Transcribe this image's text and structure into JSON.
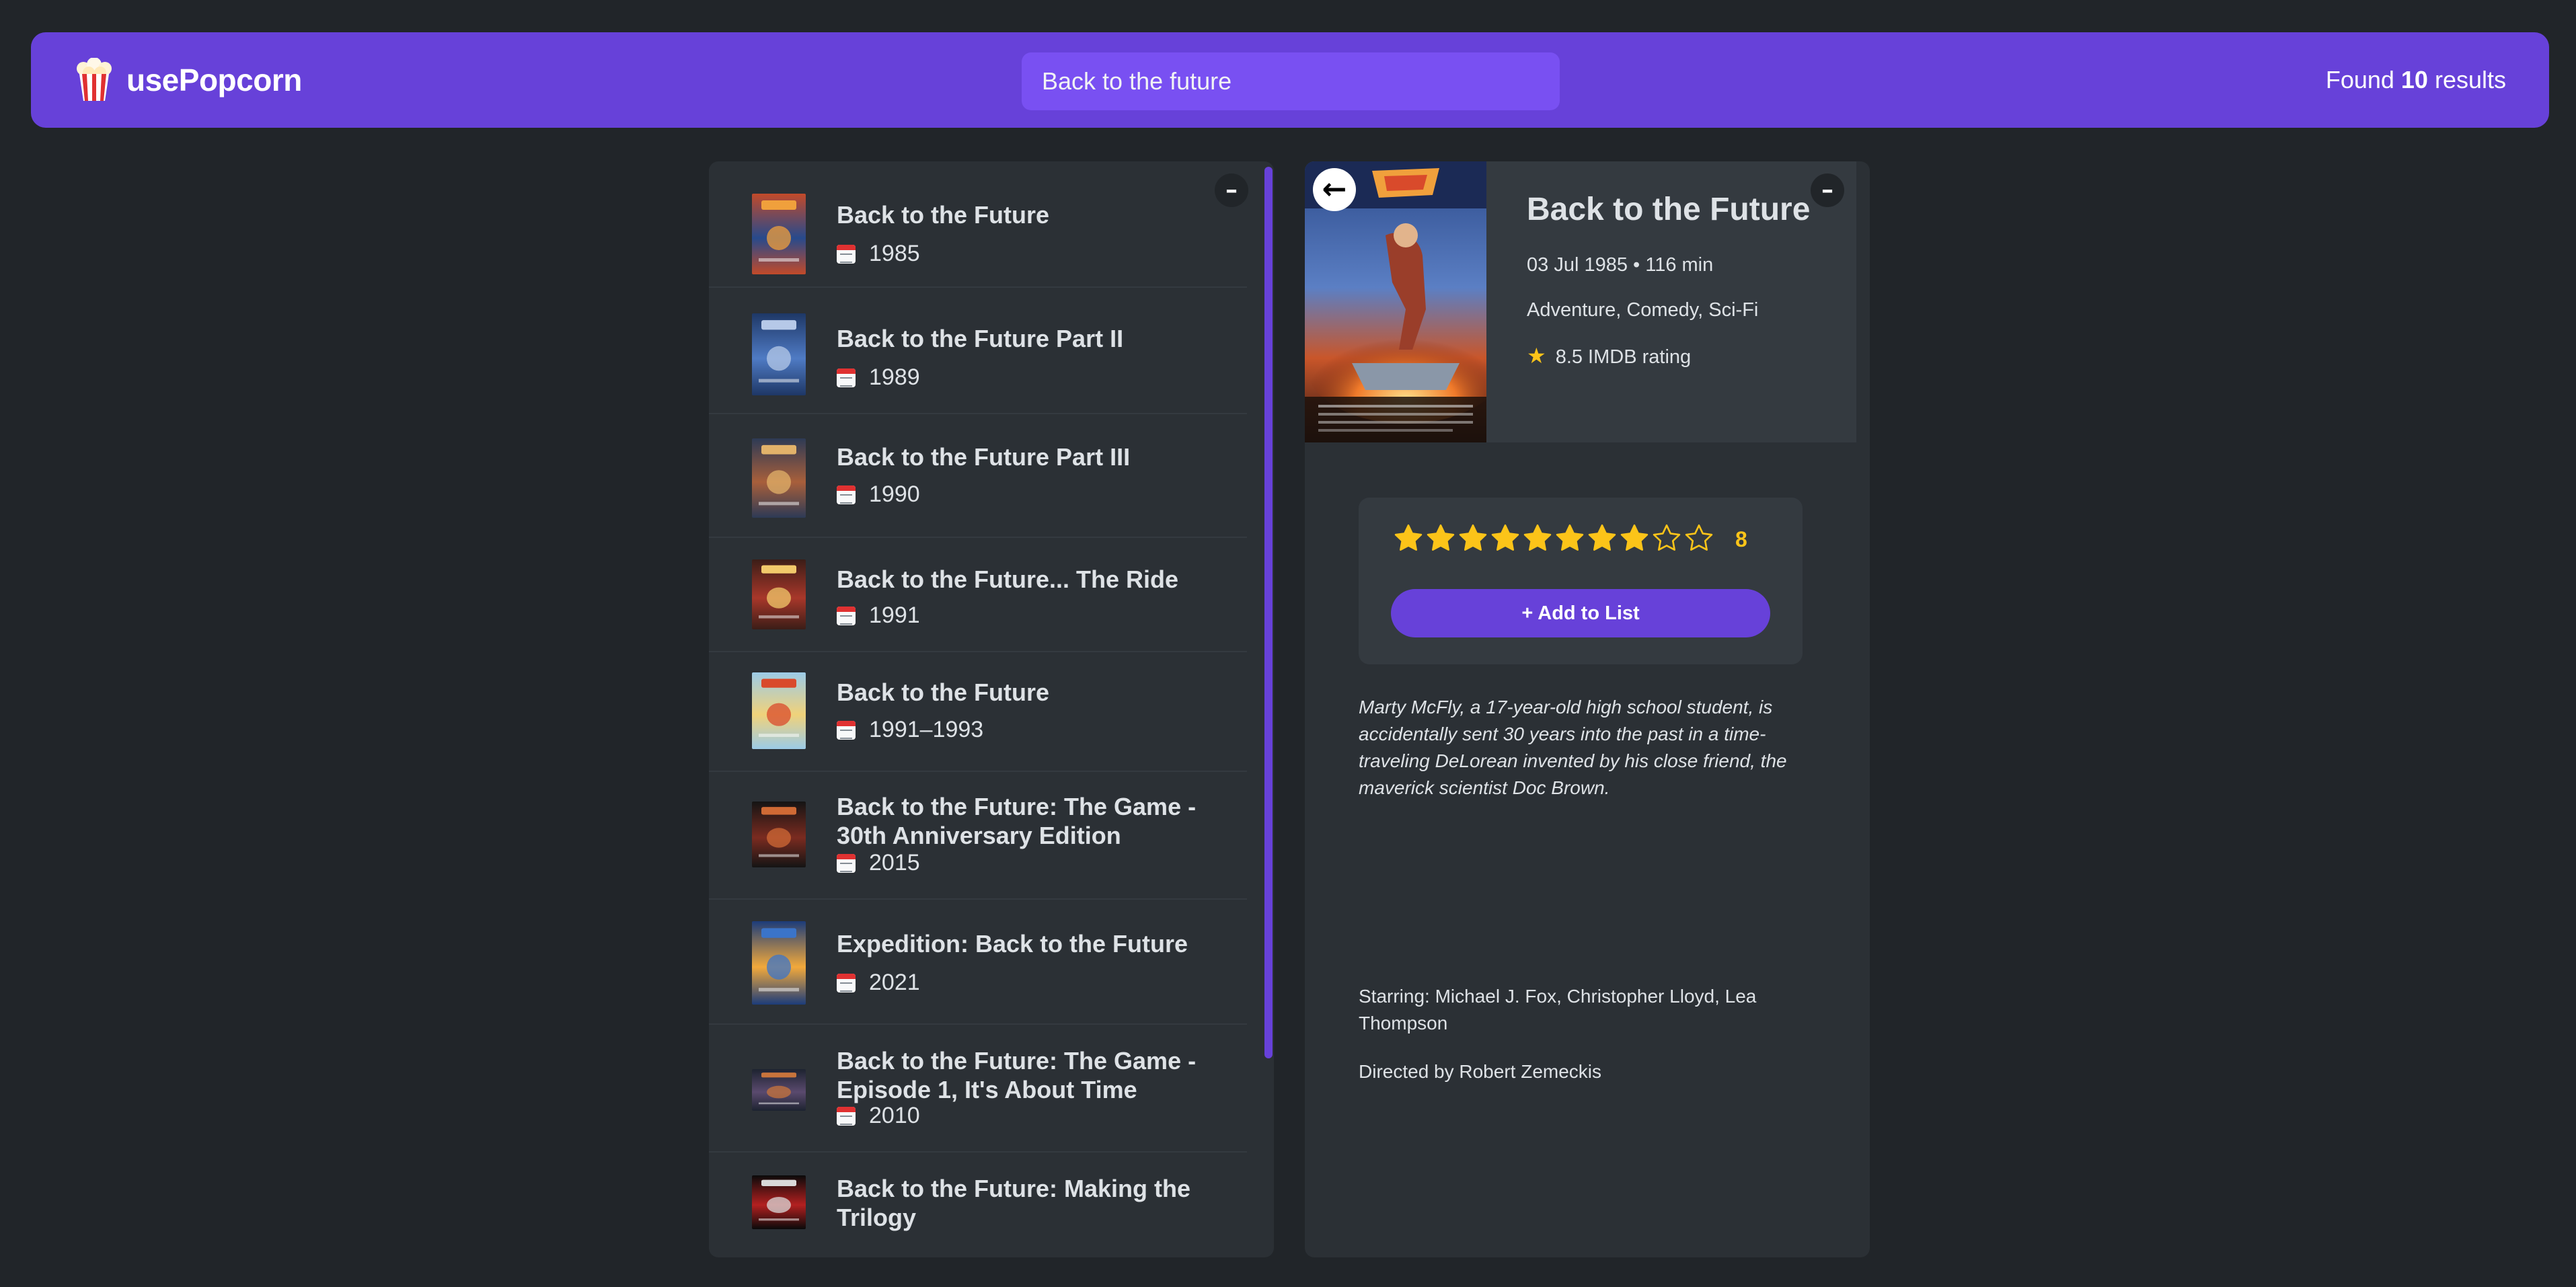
{
  "nav": {
    "logo_text": "usePopcorn",
    "search_value": "Back to the future",
    "results_prefix": "Found ",
    "results_count": "10",
    "results_suffix": " results"
  },
  "toggle_label": "–",
  "movies": [
    {
      "title": "Back to the Future",
      "year": "1985",
      "poster_colors": [
        "#c24a2a",
        "#274a8c",
        "#f0a03c"
      ]
    },
    {
      "title": "Back to the Future Part II",
      "year": "1989",
      "poster_colors": [
        "#1e3766",
        "#4f7bc4",
        "#b6c9e8"
      ]
    },
    {
      "title": "Back to the Future Part III",
      "year": "1990",
      "poster_colors": [
        "#2d3a55",
        "#a85f3b",
        "#e2b26a"
      ]
    },
    {
      "title": "Back to the Future... The Ride",
      "year": "1991",
      "poster_colors": [
        "#3b1d17",
        "#a8372a",
        "#f1c96b"
      ]
    },
    {
      "title": "Back to the Future",
      "year": "1991–1993",
      "poster_colors": [
        "#9ccbe8",
        "#f0d27a",
        "#d94a2b"
      ]
    },
    {
      "title": "Back to the Future: The Game - 30th Anniversary Edition",
      "year": "2015",
      "poster_colors": [
        "#141414",
        "#7a2b20",
        "#d06a35"
      ]
    },
    {
      "title": "Expedition: Back to the Future",
      "year": "2021",
      "poster_colors": [
        "#1c3c7a",
        "#f2a93b",
        "#3b74c9"
      ]
    },
    {
      "title": "Back to the Future: The Game - Episode 1, It's About Time",
      "year": "2010",
      "poster_colors": [
        "#1d2330",
        "#5a4a6e",
        "#c8743c"
      ]
    },
    {
      "title": "Back to the Future: Making the Trilogy",
      "year": "",
      "poster_colors": [
        "#0a0a0a",
        "#b32020",
        "#d9d9d9"
      ]
    }
  ],
  "details": {
    "back_label": "←",
    "title": "Back to the Future",
    "released_runtime": "03 Jul 1985 • 116 min",
    "genre": "Adventure, Comedy, Sci-Fi",
    "imdb_rating": "8.5 IMDB rating",
    "user_rating": "8",
    "max_rating": 10,
    "add_button": "+ Add to List",
    "plot": "Marty McFly, a 17-year-old high school student, is accidentally sent 30 years into the past in a time-traveling DeLorean invented by his close friend, the maverick scientist Doc Brown.",
    "starring": "Starring: Michael J. Fox, Christopher Lloyd, Lea Thompson",
    "director": "Directed by Robert Zemeckis"
  },
  "colors": {
    "primary": "#6741d9",
    "primary_light": "#7950f2",
    "background": "#212529",
    "panel": "#2b3035",
    "star": "#fcc419"
  }
}
